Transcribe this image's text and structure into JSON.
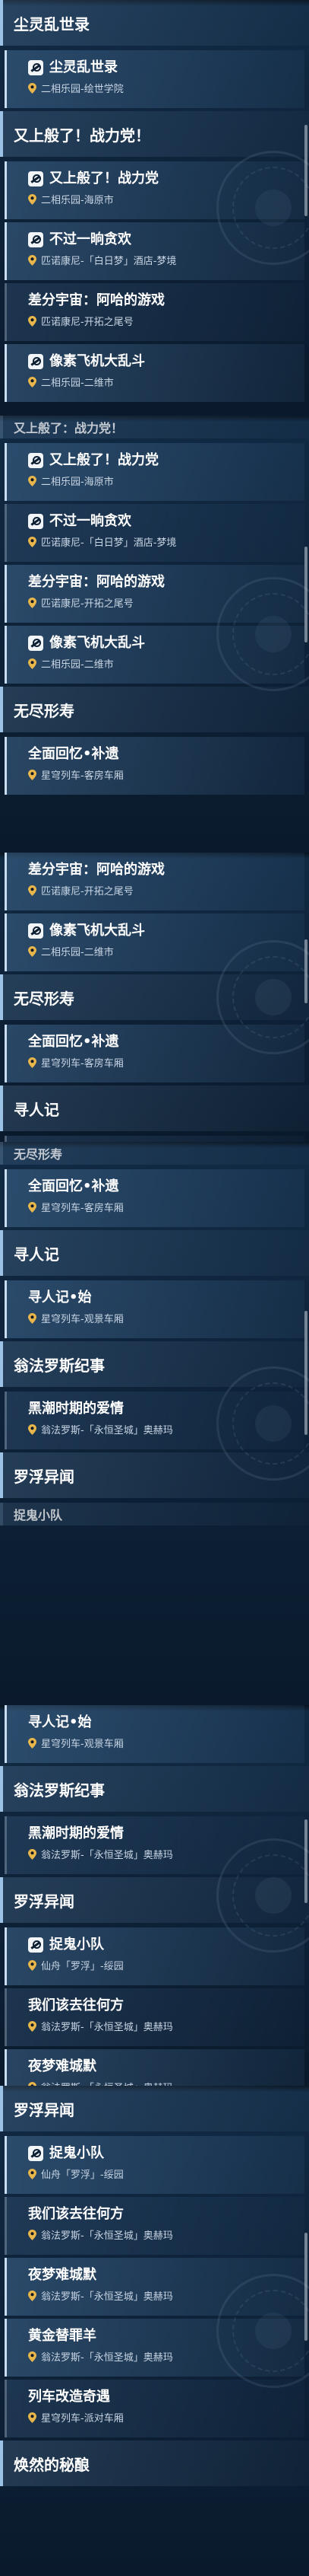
{
  "segments": [
    {
      "rows": [
        {
          "kind": "header",
          "title": "尘灵乱世录"
        },
        {
          "kind": "item",
          "icon": "star-icon",
          "title": "尘灵乱世录",
          "location": "二相乐园-绘世学院"
        },
        {
          "kind": "header",
          "title": "又上般了！战力党！"
        },
        {
          "kind": "item",
          "icon": "star-icon",
          "title": "又上般了！战力党",
          "location": "二相乐园-海原市"
        },
        {
          "kind": "item",
          "icon": "star-icon",
          "title": "不过一晌贪欢",
          "location": "匹诺康尼-「白日梦」酒店-梦境"
        },
        {
          "kind": "item",
          "icon": "",
          "title": "差分宇宙：阿哈的游戏",
          "location": "匹诺康尼-开拓之尾号"
        },
        {
          "kind": "item",
          "icon": "star-icon",
          "title": "像素飞机大乱斗",
          "location": "二相乐园-二维市"
        }
      ]
    },
    {
      "rows": [
        {
          "kind": "cut",
          "title": "又上般了：战力党！"
        },
        {
          "kind": "item",
          "icon": "star-icon",
          "title": "又上般了！战力党",
          "location": "二相乐园-海原市"
        },
        {
          "kind": "item",
          "icon": "star-icon",
          "title": "不过一晌贪欢",
          "location": "匹诺康尼-「白日梦」酒店-梦境"
        },
        {
          "kind": "item",
          "icon": "",
          "title": "差分宇宙：阿哈的游戏",
          "location": "匹诺康尼-开拓之尾号"
        },
        {
          "kind": "item",
          "icon": "star-icon",
          "title": "像素飞机大乱斗",
          "location": "二相乐园-二维市"
        },
        {
          "kind": "header",
          "title": "无尽形寿"
        },
        {
          "kind": "item",
          "icon": "",
          "title": "全面回忆•补遗",
          "location": "星穹列车-客房车厢"
        }
      ]
    },
    {
      "rows": [
        {
          "kind": "item",
          "icon": "",
          "title": "差分宇宙：阿哈的游戏",
          "location": "匹诺康尼-开拓之尾号"
        },
        {
          "kind": "item",
          "icon": "star-icon",
          "title": "像素飞机大乱斗",
          "location": "二相乐园-二维市"
        },
        {
          "kind": "header",
          "title": "无尽形寿"
        },
        {
          "kind": "item",
          "icon": "",
          "title": "全面回忆•补遗",
          "location": "星穹列车-客房车厢"
        },
        {
          "kind": "header",
          "title": "寻人记"
        },
        {
          "kind": "item",
          "icon": "",
          "title": "寻人记•始",
          "location": "星穹列车-观景车厢"
        },
        {
          "kind": "header",
          "title": "翁法罗斯纪事"
        }
      ]
    },
    {
      "rows": [
        {
          "kind": "cut",
          "title": "无尽形寿"
        },
        {
          "kind": "item",
          "icon": "",
          "title": "全面回忆•补遗",
          "location": "星穹列车-客房车厢"
        },
        {
          "kind": "header",
          "title": "寻人记"
        },
        {
          "kind": "item",
          "icon": "",
          "title": "寻人记•始",
          "location": "星穹列车-观景车厢"
        },
        {
          "kind": "header",
          "title": "翁法罗斯纪事"
        },
        {
          "kind": "item",
          "icon": "",
          "title": "黑潮时期的爱情",
          "location": "翁法罗斯-「永恒圣城」奥赫玛"
        },
        {
          "kind": "header",
          "title": "罗浮异闻"
        },
        {
          "kind": "cut",
          "title": "捉鬼小队"
        }
      ]
    },
    {
      "rows": [
        {
          "kind": "item",
          "icon": "",
          "title": "寻人记•始",
          "location": "星穹列车-观景车厢"
        },
        {
          "kind": "header",
          "title": "翁法罗斯纪事"
        },
        {
          "kind": "item",
          "icon": "",
          "title": "黑潮时期的爱情",
          "location": "翁法罗斯-「永恒圣城」奥赫玛"
        },
        {
          "kind": "header",
          "title": "罗浮异闻"
        },
        {
          "kind": "item",
          "icon": "star-icon",
          "title": "捉鬼小队",
          "location": "仙舟「罗浮」-绥园"
        },
        {
          "kind": "item",
          "icon": "",
          "title": "我们该去往何方",
          "location": "翁法罗斯-「永恒圣城」奥赫玛"
        },
        {
          "kind": "item",
          "icon": "",
          "title": "夜梦难城默",
          "location": "翁法罗斯-「永恒圣城」奥赫玛"
        }
      ]
    },
    {
      "rows": [
        {
          "kind": "header",
          "title": "罗浮异闻"
        },
        {
          "kind": "item",
          "icon": "star-icon",
          "title": "捉鬼小队",
          "location": "仙舟「罗浮」-绥园"
        },
        {
          "kind": "item",
          "icon": "",
          "title": "我们该去往何方",
          "location": "翁法罗斯-「永恒圣城」奥赫玛"
        },
        {
          "kind": "item",
          "icon": "",
          "title": "夜梦难城默",
          "location": "翁法罗斯-「永恒圣城」奥赫玛"
        },
        {
          "kind": "item",
          "icon": "",
          "title": "黄金替罪羊",
          "location": "翁法罗斯-「永恒圣城」奥赫玛"
        },
        {
          "kind": "item",
          "icon": "",
          "title": "列车改造奇遇",
          "location": "星穹列车-派对车厢"
        },
        {
          "kind": "header",
          "title": "焕然的秘酿"
        }
      ]
    }
  ]
}
